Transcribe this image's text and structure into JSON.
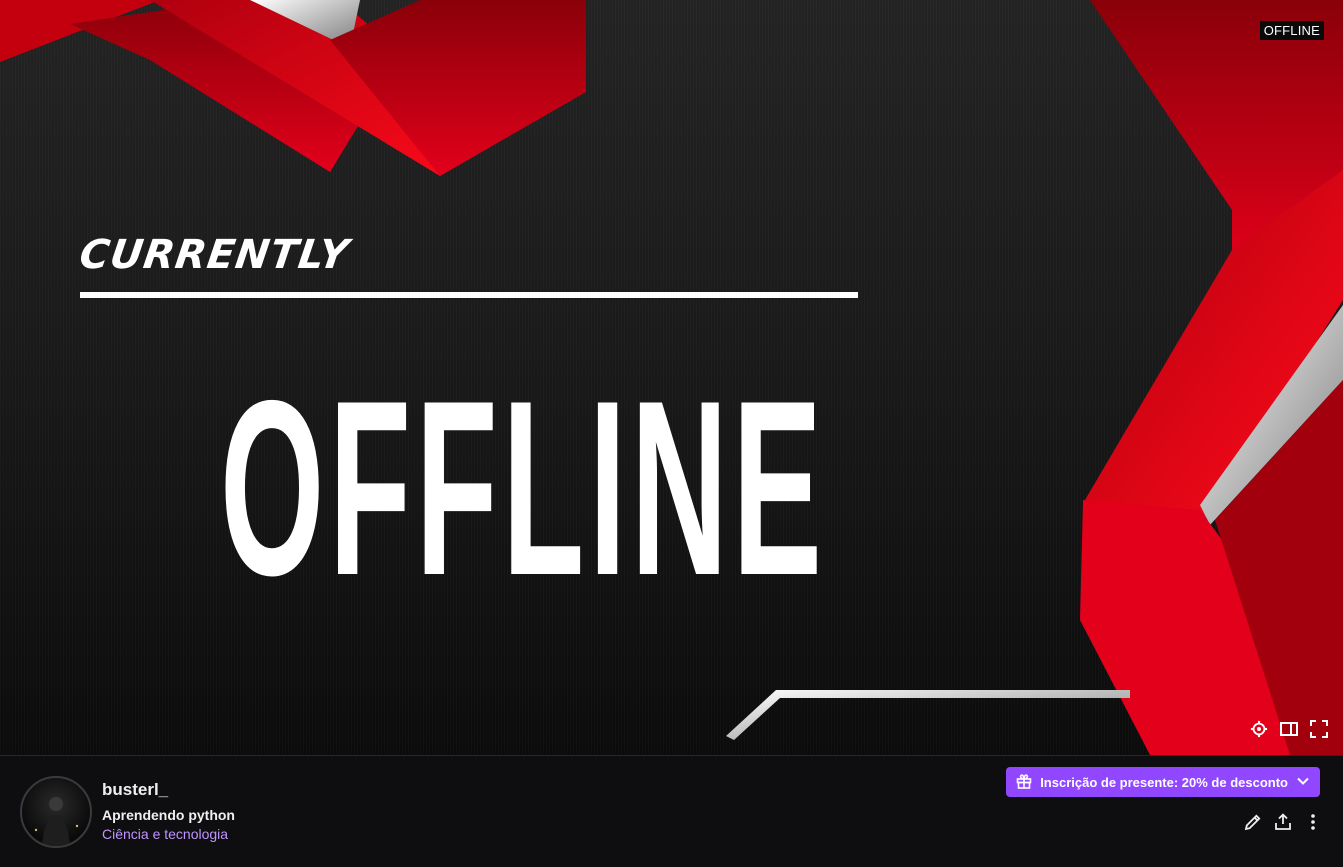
{
  "player": {
    "status_badge": "OFFLINE",
    "banner_small_text": "CURRENTLY",
    "banner_big_text": "OFFLINE",
    "controls": [
      {
        "name": "settings-icon"
      },
      {
        "name": "theatre-mode-icon"
      },
      {
        "name": "fullscreen-icon"
      }
    ]
  },
  "channel": {
    "name": "busterl_",
    "stream_title": "Aprendendo python",
    "category": "Ciência e tecnologia"
  },
  "gift_button": {
    "label": "Inscrição de presente: 20% de desconto",
    "icon": "gift-icon"
  },
  "actions": [
    {
      "name": "edit-icon"
    },
    {
      "name": "share-icon"
    },
    {
      "name": "more-options-icon"
    }
  ],
  "colors": {
    "accent": "#9147ff",
    "category_link": "#bf94ff",
    "banner_red": "#e3001b",
    "background": "#0e0e10"
  }
}
